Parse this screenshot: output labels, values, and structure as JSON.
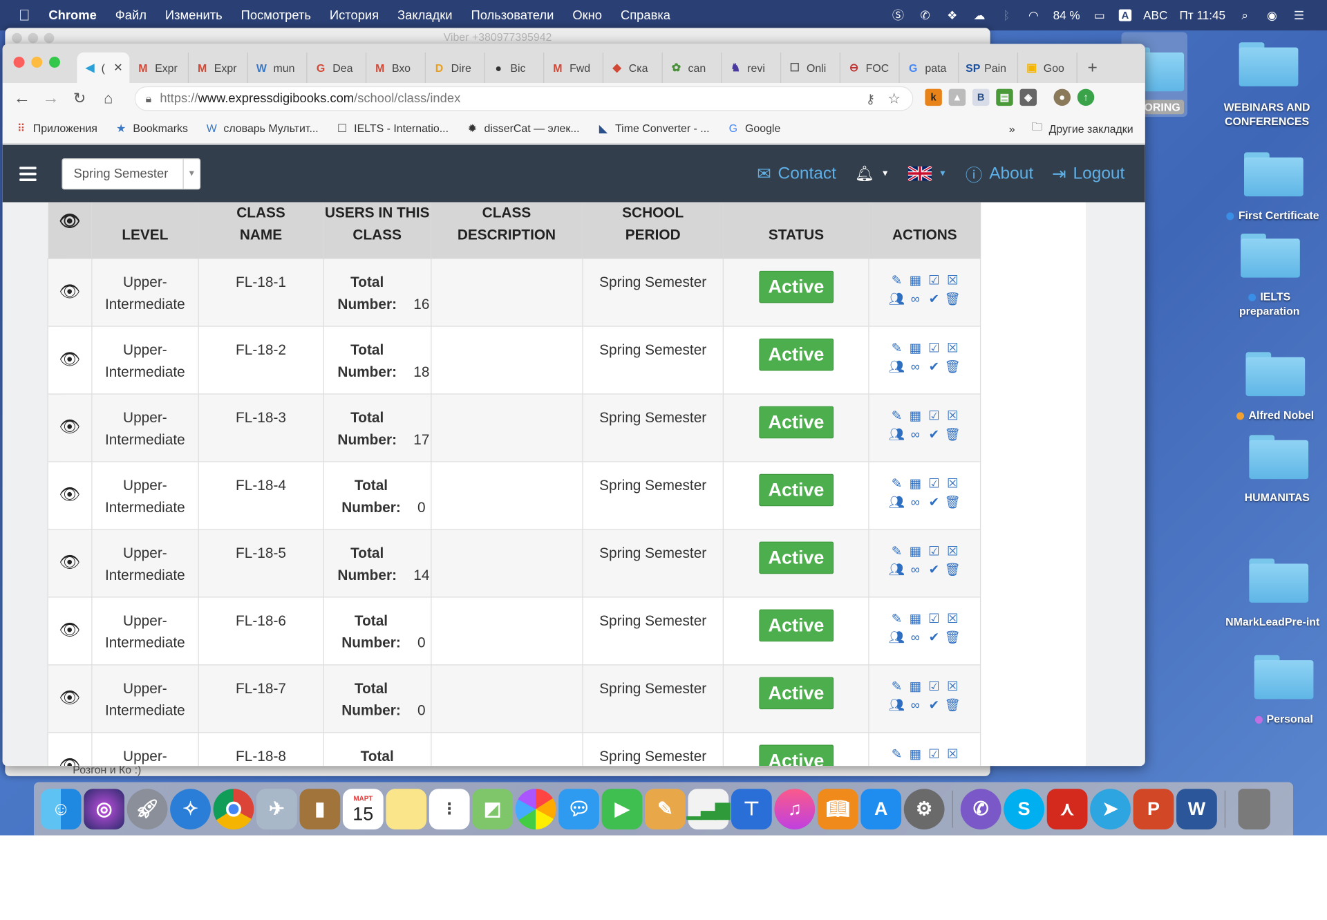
{
  "menubar": {
    "apple": "",
    "app": "Chrome",
    "items": [
      "Файл",
      "Изменить",
      "Посмотреть",
      "История",
      "Закладки",
      "Пользователи",
      "Окно",
      "Справка"
    ],
    "battery": "84 %",
    "input": "ABC",
    "clock": "Пт 11:45"
  },
  "viber": {
    "title": "Viber +380977395942",
    "footer": "Розгон и Ко :)"
  },
  "tabs": [
    {
      "icon": "◀",
      "label": "(",
      "active": true,
      "color": "#2aa0d8"
    },
    {
      "icon": "M",
      "label": "Expr",
      "color": "#d14836"
    },
    {
      "icon": "M",
      "label": "Expr",
      "color": "#d14836"
    },
    {
      "icon": "W",
      "label": "mun",
      "color": "#3a78c3"
    },
    {
      "icon": "G",
      "label": "Dea",
      "color": "#d14836"
    },
    {
      "icon": "M",
      "label": "Вхо",
      "color": "#d14836"
    },
    {
      "icon": "D",
      "label": "Dire",
      "color": "#e8a020"
    },
    {
      "icon": "●",
      "label": "Віс",
      "color": "#333"
    },
    {
      "icon": "M",
      "label": "Fwd",
      "color": "#d14836"
    },
    {
      "icon": "◆",
      "label": "Ска",
      "color": "#d14836"
    },
    {
      "icon": "✿",
      "label": "can",
      "color": "#4a8f3a"
    },
    {
      "icon": "♞",
      "label": "revi",
      "color": "#4a3aa0"
    },
    {
      "icon": "☐",
      "label": "Onli",
      "color": "#555"
    },
    {
      "icon": "⊖",
      "label": "FOC",
      "color": "#c03030"
    },
    {
      "icon": "G",
      "label": "pata",
      "color": "#4285f4"
    },
    {
      "icon": "SP",
      "label": "Pain",
      "color": "#1a4fa0"
    },
    {
      "icon": "▣",
      "label": "Goo",
      "color": "#f4b400"
    }
  ],
  "url": {
    "scheme": "https://",
    "host": "www.expressdigibooks.com",
    "path": "/school/class/index"
  },
  "bookmarks": [
    {
      "icon": "⠿",
      "label": "Приложения",
      "color": "#d14836"
    },
    {
      "icon": "★",
      "label": "Bookmarks",
      "color": "#3a78c3"
    },
    {
      "icon": "W",
      "label": "словарь Мультит...",
      "color": "#3a78c3"
    },
    {
      "icon": "☐",
      "label": "IELTS - Internatio...",
      "color": "#555"
    },
    {
      "icon": "✹",
      "label": "disserCat — элек...",
      "color": "#333"
    },
    {
      "icon": "◣",
      "label": "Time Converter - ...",
      "color": "#2a4f8a"
    },
    {
      "icon": "G",
      "label": "Google",
      "color": "#4285f4"
    }
  ],
  "bookmarks_more": "»",
  "bookmarks_other": "Другие закладки",
  "nav": {
    "semester": "Spring Semester",
    "contact": "Contact",
    "about": "About",
    "logout": "Logout"
  },
  "table": {
    "headers": {
      "level": "LEVEL",
      "class_name": "CLASS NAME",
      "users": "USERS IN THIS CLASS",
      "description": "CLASS DESCRIPTION",
      "period": "SCHOOL PERIOD",
      "status": "STATUS",
      "actions": "ACTIONS"
    },
    "total_label": "Total Number:",
    "rows": [
      {
        "level": "Upper-Intermediate",
        "name": "FL-18-1",
        "total": "16",
        "description": "",
        "period": "Spring Semester",
        "status": "Active"
      },
      {
        "level": "Upper-Intermediate",
        "name": "FL-18-2",
        "total": "18",
        "description": "",
        "period": "Spring Semester",
        "status": "Active"
      },
      {
        "level": "Upper-Intermediate",
        "name": "FL-18-3",
        "total": "17",
        "description": "",
        "period": "Spring Semester",
        "status": "Active"
      },
      {
        "level": "Upper-Intermediate",
        "name": "FL-18-4",
        "total": "0",
        "description": "",
        "period": "Spring Semester",
        "status": "Active"
      },
      {
        "level": "Upper-Intermediate",
        "name": "FL-18-5",
        "total": "14",
        "description": "",
        "period": "Spring Semester",
        "status": "Active"
      },
      {
        "level": "Upper-Intermediate",
        "name": "FL-18-6",
        "total": "0",
        "description": "",
        "period": "Spring Semester",
        "status": "Active"
      },
      {
        "level": "Upper-Intermediate",
        "name": "FL-18-7",
        "total": "0",
        "description": "",
        "period": "Spring Semester",
        "status": "Active"
      },
      {
        "level": "Upper-Intermediate",
        "name": "FL-18-8",
        "total": "",
        "description": "",
        "period": "Spring Semester",
        "status": "Active"
      }
    ]
  },
  "desktop": {
    "oring": "ORING",
    "folders": [
      {
        "label": "WEBINARS AND\nCONFERENCES",
        "dot": ""
      },
      {
        "label": "First Certificate",
        "dot": "#3a8ee6"
      },
      {
        "label": "IELTS\npreparation",
        "dot": "#3a8ee6"
      },
      {
        "label": "Alfred Nobel",
        "dot": "#f0a030"
      },
      {
        "label": "HUMANITAS",
        "dot": ""
      },
      {
        "label": "NMarkLeadPre-int",
        "dot": ""
      },
      {
        "label": "Personal",
        "dot": "#c070e0"
      }
    ]
  },
  "dock": {
    "calendar_month": "МАРТ",
    "calendar_day": "15"
  },
  "colors": {
    "nav_bg": "#323e4c",
    "link": "#5fb0e6",
    "active": "#4cae4c",
    "action_icon": "#2f6fc2",
    "scroll_top": "#e8332b"
  }
}
